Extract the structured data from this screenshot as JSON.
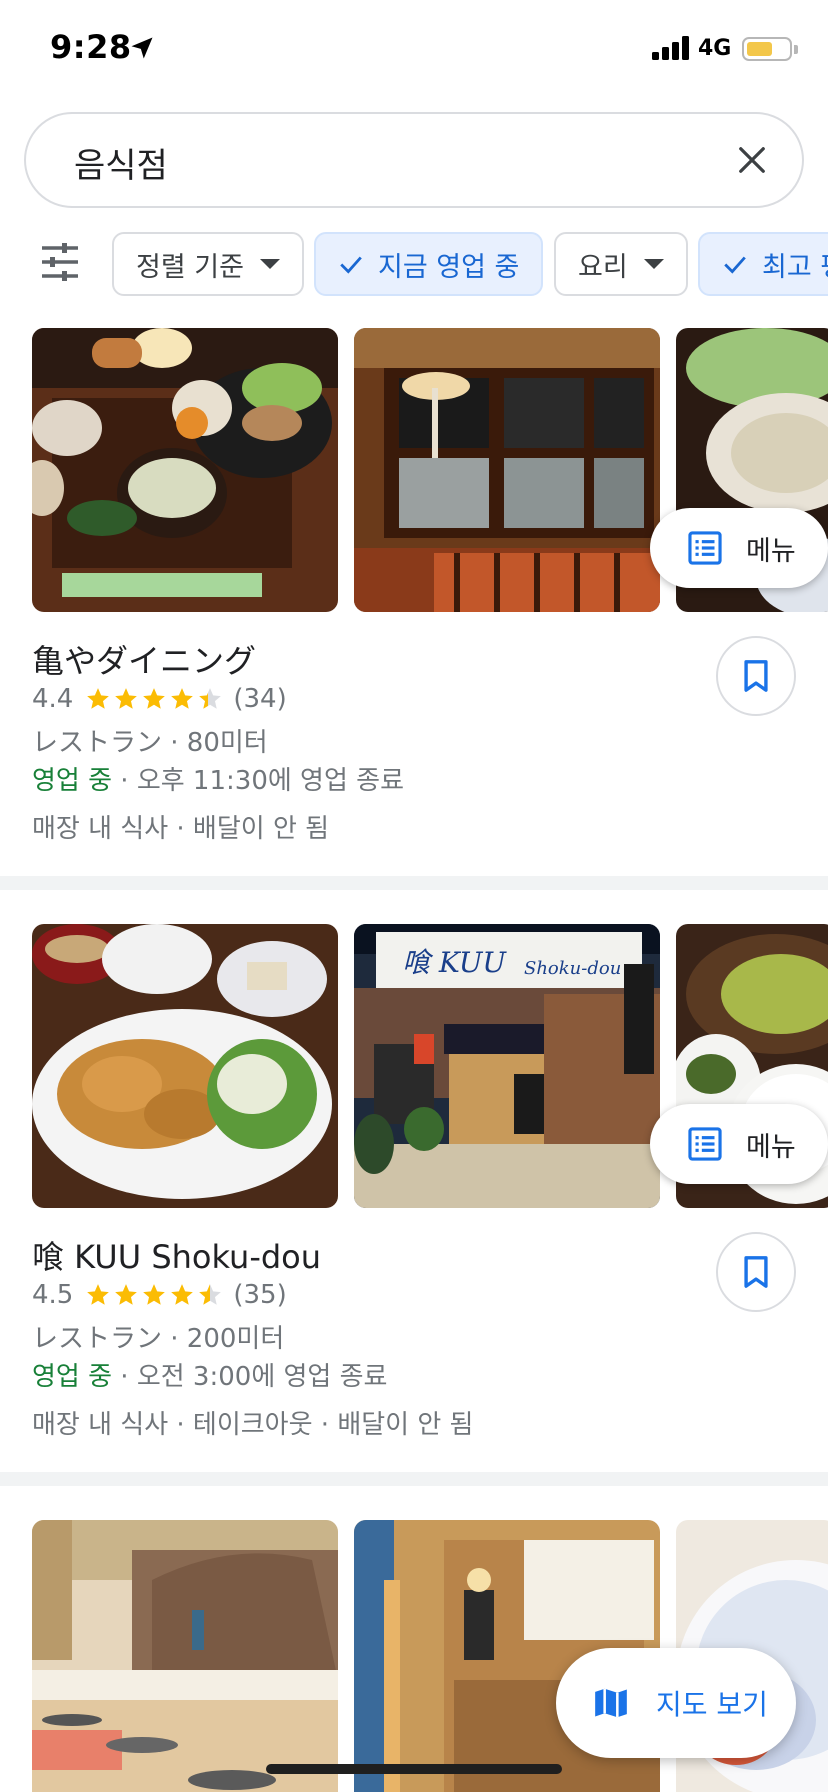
{
  "status_bar": {
    "time": "9:28",
    "network": "4G",
    "battery_level": 0.6
  },
  "search": {
    "query": "음식점"
  },
  "filters": {
    "chips": [
      {
        "label": "정렬 기준",
        "selected": false,
        "dropdown": true
      },
      {
        "label": "지금 영업 중",
        "selected": true,
        "dropdown": false
      },
      {
        "label": "요리",
        "selected": false,
        "dropdown": true
      },
      {
        "label": "최고 평",
        "selected": true,
        "dropdown": false
      }
    ]
  },
  "menu_label": "메뉴",
  "results": [
    {
      "name": "亀やダイニング",
      "rating": "4.4",
      "rating_value": 4.4,
      "reviews": "(34)",
      "category_distance": "レストラン · 80미터",
      "open_status": "영업 중",
      "hours": " · 오후 11:30에 영업 종료",
      "services": "매장 내 식사 · 배달이 안 됨"
    },
    {
      "name": "喰 KUU Shoku-dou",
      "rating": "4.5",
      "rating_value": 4.5,
      "reviews": "(35)",
      "category_distance": "レストラン · 200미터",
      "open_status": "영업 중",
      "hours": " · 오전 3:00에 영업 종료",
      "services": "매장 내 식사 · 테이크아웃 · 배달이 안 됨"
    }
  ],
  "map_button": {
    "label": "지도 보기"
  },
  "colors": {
    "accent": "#1a73e8",
    "open_green": "#188038",
    "star": "#fbbc04",
    "chip_selected_bg": "#e8f0fe"
  },
  "icons": [
    "location-arrow-icon",
    "signal-icon",
    "battery-icon",
    "close-icon",
    "filter-sliders-icon",
    "check-icon",
    "chevron-down-icon",
    "menu-list-icon",
    "bookmark-icon",
    "star-icon",
    "map-icon"
  ]
}
